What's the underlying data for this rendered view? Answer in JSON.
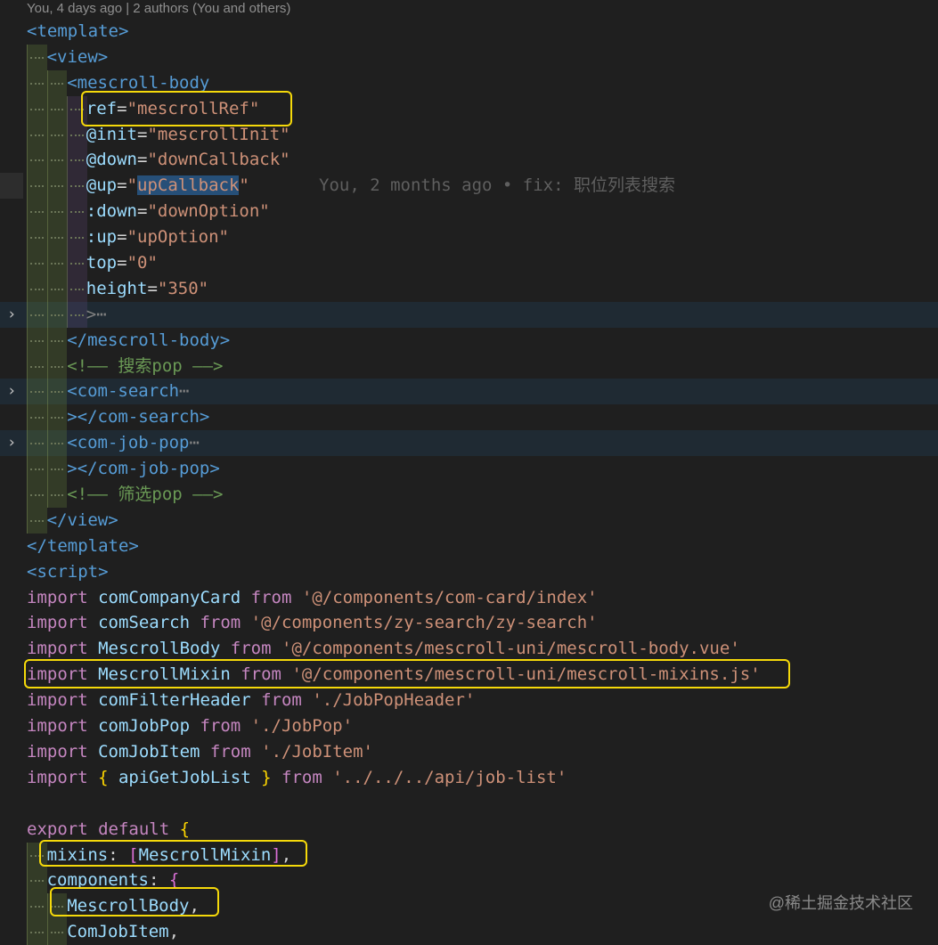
{
  "blame_header": "You, 4 days ago | 2 authors (You and others)",
  "inline_blame": "You, 2 months ago • fix: 职位列表搜索",
  "fold_icon": "chevron-right-icon",
  "lines": [
    {
      "guides": 0,
      "tokens": [
        [
          "tg",
          "<template>"
        ]
      ]
    },
    {
      "guides": 1,
      "tokens": [
        [
          "tg",
          "<view>"
        ]
      ]
    },
    {
      "guides": 2,
      "tokens": [
        [
          "tg",
          "<mescroll-body"
        ]
      ]
    },
    {
      "guides": 3,
      "tokens": [
        [
          "at",
          "ref"
        ],
        [
          "eq",
          "="
        ],
        [
          "st",
          "\"mescrollRef\""
        ]
      ]
    },
    {
      "guides": 3,
      "tokens": [
        [
          "at",
          "@init"
        ],
        [
          "eq",
          "="
        ],
        [
          "st",
          "\"mescrollInit\""
        ]
      ]
    },
    {
      "guides": 3,
      "tokens": [
        [
          "at",
          "@down"
        ],
        [
          "eq",
          "="
        ],
        [
          "st",
          "\"downCallback\""
        ]
      ]
    },
    {
      "guides": 3,
      "current": true,
      "blame": true,
      "tokens": [
        [
          "at",
          "@up"
        ],
        [
          "eq",
          "="
        ],
        [
          "st",
          "\""
        ],
        [
          "st hl",
          "upCallback"
        ],
        [
          "st",
          "\""
        ]
      ]
    },
    {
      "guides": 3,
      "tokens": [
        [
          "at",
          ":down"
        ],
        [
          "eq",
          "="
        ],
        [
          "st",
          "\"downOption\""
        ]
      ]
    },
    {
      "guides": 3,
      "tokens": [
        [
          "at",
          ":up"
        ],
        [
          "eq",
          "="
        ],
        [
          "st",
          "\"upOption\""
        ]
      ]
    },
    {
      "guides": 3,
      "tokens": [
        [
          "at",
          "top"
        ],
        [
          "eq",
          "="
        ],
        [
          "st",
          "\"0\""
        ]
      ]
    },
    {
      "guides": 3,
      "tokens": [
        [
          "at",
          "height"
        ],
        [
          "eq",
          "="
        ],
        [
          "st",
          "\"350\""
        ]
      ]
    },
    {
      "guides": 3,
      "folded": true,
      "tokens": [
        [
          "pu",
          ">"
        ],
        [
          "pu",
          "⋯"
        ]
      ]
    },
    {
      "guides": 2,
      "tokens": [
        [
          "tg",
          "</mescroll-body>"
        ]
      ]
    },
    {
      "guides": 2,
      "tokens": [
        [
          "cm",
          "<!—— 搜索pop ——>"
        ]
      ]
    },
    {
      "guides": 2,
      "folded": true,
      "tokens": [
        [
          "tg",
          "<com-search"
        ],
        [
          "pu",
          "⋯"
        ]
      ]
    },
    {
      "guides": 2,
      "tokens": [
        [
          "tg",
          "></com-search>"
        ]
      ]
    },
    {
      "guides": 2,
      "folded": true,
      "tokens": [
        [
          "tg",
          "<com-job-pop"
        ],
        [
          "pu",
          "⋯"
        ]
      ]
    },
    {
      "guides": 2,
      "tokens": [
        [
          "tg",
          "></com-job-pop>"
        ]
      ]
    },
    {
      "guides": 2,
      "tokens": [
        [
          "cm",
          "<!—— 筛选pop ——>"
        ]
      ]
    },
    {
      "guides": 1,
      "tokens": [
        [
          "tg",
          "</view>"
        ]
      ]
    },
    {
      "guides": 0,
      "tokens": [
        [
          "tg",
          "</template>"
        ]
      ]
    },
    {
      "guides": 0,
      "tokens": [
        [
          "tg",
          "<script>"
        ]
      ]
    },
    {
      "guides": 0,
      "tokens": [
        [
          "kw",
          "import "
        ],
        [
          "id",
          "comCompanyCard "
        ],
        [
          "kw",
          "from "
        ],
        [
          "st",
          "'@/components/com-card/index'"
        ]
      ]
    },
    {
      "guides": 0,
      "tokens": [
        [
          "kw",
          "import "
        ],
        [
          "id",
          "comSearch "
        ],
        [
          "kw",
          "from "
        ],
        [
          "st",
          "'@/components/zy-search/zy-search'"
        ]
      ]
    },
    {
      "guides": 0,
      "tokens": [
        [
          "kw",
          "import "
        ],
        [
          "id",
          "MescrollBody "
        ],
        [
          "kw",
          "from "
        ],
        [
          "st",
          "'@/components/mescroll-uni/mescroll-body.vue'"
        ]
      ]
    },
    {
      "guides": 0,
      "tokens": [
        [
          "kw",
          "import "
        ],
        [
          "id",
          "MescrollMixin "
        ],
        [
          "kw",
          "from "
        ],
        [
          "st",
          "'@/components/mescroll-uni/mescroll-mixins.js'"
        ]
      ]
    },
    {
      "guides": 0,
      "tokens": [
        [
          "kw",
          "import "
        ],
        [
          "id",
          "comFilterHeader "
        ],
        [
          "kw",
          "from "
        ],
        [
          "st",
          "'./JobPopHeader'"
        ]
      ]
    },
    {
      "guides": 0,
      "tokens": [
        [
          "kw",
          "import "
        ],
        [
          "id",
          "comJobPop "
        ],
        [
          "kw",
          "from "
        ],
        [
          "st",
          "'./JobPop'"
        ]
      ]
    },
    {
      "guides": 0,
      "tokens": [
        [
          "kw",
          "import "
        ],
        [
          "id",
          "ComJobItem "
        ],
        [
          "kw",
          "from "
        ],
        [
          "st",
          "'./JobItem'"
        ]
      ]
    },
    {
      "guides": 0,
      "tokens": [
        [
          "kw",
          "import "
        ],
        [
          "br",
          "{ "
        ],
        [
          "id",
          "apiGetJobList "
        ],
        [
          "br",
          "} "
        ],
        [
          "kw",
          "from "
        ],
        [
          "st",
          "'../../../api/job-list'"
        ]
      ]
    },
    {
      "guides": 0,
      "tokens": []
    },
    {
      "guides": 0,
      "tokens": [
        [
          "kw",
          "export default "
        ],
        [
          "br",
          "{"
        ]
      ]
    },
    {
      "guides": 1,
      "tokens": [
        [
          "id",
          "mixins"
        ],
        [
          "wh",
          ": "
        ],
        [
          "br2",
          "["
        ],
        [
          "id",
          "MescrollMixin"
        ],
        [
          "br2",
          "]"
        ],
        [
          "wh",
          ","
        ]
      ]
    },
    {
      "guides": 1,
      "tokens": [
        [
          "id",
          "components"
        ],
        [
          "wh",
          ": "
        ],
        [
          "br2",
          "{"
        ]
      ]
    },
    {
      "guides": 2,
      "tokens": [
        [
          "id",
          "MescrollBody"
        ],
        [
          "wh",
          ","
        ]
      ]
    },
    {
      "guides": 2,
      "tokens": [
        [
          "id",
          "ComJobItem"
        ],
        [
          "wh",
          ","
        ]
      ]
    }
  ],
  "watermark": "@稀土掘金技术社区"
}
